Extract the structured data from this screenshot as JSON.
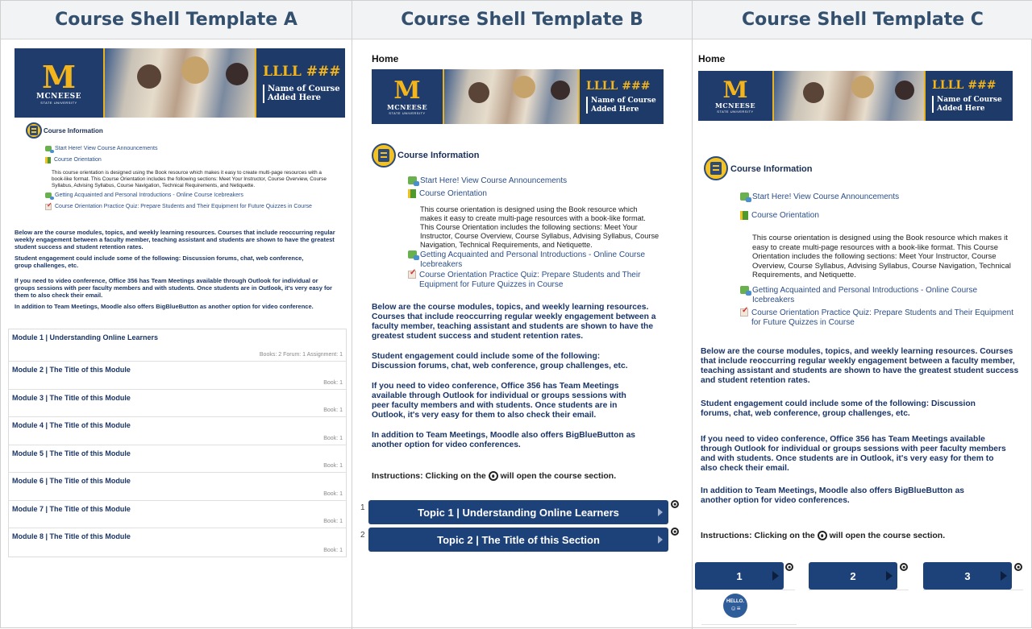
{
  "columns": [
    {
      "title": "Course Shell Template A"
    },
    {
      "title": "Course Shell Template B"
    },
    {
      "title": "Course Shell Template C"
    }
  ],
  "home_label": "Home",
  "banner": {
    "logo_letter": "M",
    "logo_name": "MCNEESE",
    "logo_sub": "STATE UNIVERSITY",
    "course_code": "LLLL ###",
    "course_name_line1": "Name of Course",
    "course_name_line2": "Added Here"
  },
  "course_info": {
    "title": "Course Information",
    "items": [
      {
        "icon": "announcement-icon",
        "label": "Start Here! View Course Announcements"
      },
      {
        "icon": "book-icon",
        "label": "Course Orientation"
      }
    ],
    "description": "This course orientation is designed using the Book resource which makes it easy to create multi-page resources with a book-like format.  This Course Orientation includes the following sections: Meet Your Instructor, Course Overview, Course Syllabus, Advising Syllabus, Course Navigation, Technical Requirements, and Netiquette.",
    "items2": [
      {
        "icon": "forum-icon",
        "label": "Getting Acquainted and Personal Introductions - Online Course Icebreakers"
      },
      {
        "icon": "quiz-icon",
        "label": "Course Orientation Practice Quiz: Prepare Students and Their Equipment for Future Quizzes in Course"
      }
    ]
  },
  "paragraphs": [
    "Below are the course modules, topics, and weekly learning resources.  Courses that include reoccurring regular weekly engagement between a faculty member, teaching assistant and students are shown to have the greatest student success and student retention rates.",
    "Student engagement could include some of the following: Discussion forums, chat, web conference, group challenges, etc.",
    "If you need to video conference, Office 356 has Team Meetings available through Outlook for individual or groups sessions with peer faculty members and with students.  Once students are in Outlook, it's very easy for them to also check their email.",
    "In addition to Team Meetings, Moodle also offers BigBlueButton as another option for video conference.",
    "In addition to Team Meetings, Moodle also offers BigBlueButton as another option for video conferences."
  ],
  "instructions": {
    "before": "Instructions: Clicking on the",
    "after": "will open the course section."
  },
  "modules": [
    {
      "title": "Module 1 | Understanding Online Learners",
      "counts": "Books: 2 Forum: 1 Assignment: 1"
    },
    {
      "title": "Module 2 | The Title of this Module",
      "counts": "Book: 1"
    },
    {
      "title": "Module 3 | The Title of this Module",
      "counts": "Book: 1"
    },
    {
      "title": "Module 4 | The Title of this Module",
      "counts": "Book: 1"
    },
    {
      "title": "Module 5 | The Title of this Module",
      "counts": "Book: 1"
    },
    {
      "title": "Module 6 | The Title of this Module",
      "counts": "Book: 1"
    },
    {
      "title": "Module 7 | The Title of this Module",
      "counts": "Book: 1"
    },
    {
      "title": "Module 8 | The Title of this Module",
      "counts": "Book: 1"
    }
  ],
  "topics": [
    {
      "number": "1",
      "title": "Topic 1 | Understanding Online Learners"
    },
    {
      "number": "2",
      "title": "Topic 2 | The Title of this Section"
    }
  ],
  "tiles": [
    "1",
    "2",
    "3"
  ],
  "hello_badge": {
    "line1": "HELLO."
  },
  "colors": {
    "navy": "#1d4179",
    "gold": "#f3b51b",
    "link": "#2c4f88"
  }
}
